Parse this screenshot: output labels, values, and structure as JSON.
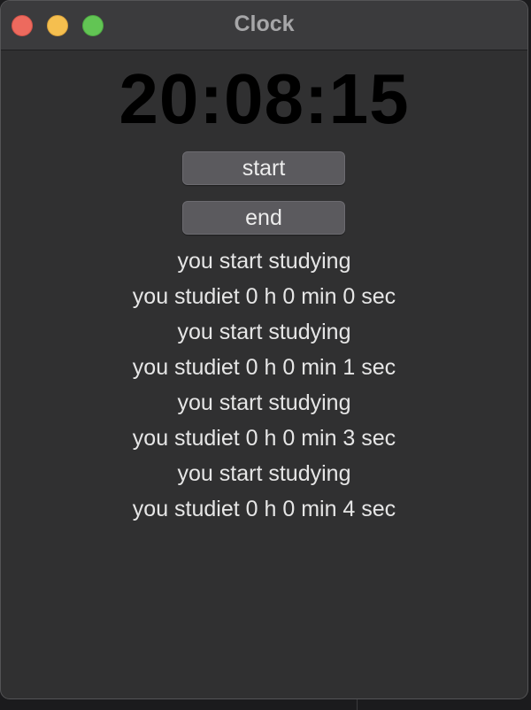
{
  "window": {
    "title": "Clock"
  },
  "clock": {
    "time": "20:08:15"
  },
  "buttons": {
    "start_label": "start",
    "end_label": "end"
  },
  "log": [
    "you start studying",
    "you studiet 0 h 0 min 0 sec",
    "you start studying",
    "you studiet 0 h 0 min 1 sec",
    "you start studying",
    "you studiet 0 h 0 min 3 sec",
    "you start studying",
    "you studiet 0 h 0 min 4 sec"
  ],
  "colors": {
    "window_bg": "#303031",
    "titlebar_bg": "#3b3b3d",
    "close": "#ed6a5e",
    "minimize": "#f5bf4f",
    "zoom": "#62c554",
    "clock_text": "#000000",
    "button_bg": "#5b5a5e",
    "text": "#e6e6e6"
  }
}
